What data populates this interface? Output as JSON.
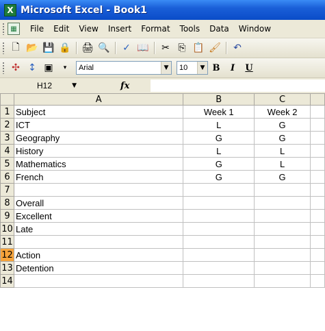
{
  "window": {
    "title": "Microsoft Excel - Book1",
    "app_icon_glyph": "X"
  },
  "menubar": {
    "items": [
      "File",
      "Edit",
      "View",
      "Insert",
      "Format",
      "Tools",
      "Data",
      "Window"
    ]
  },
  "formatting": {
    "font": "Arial",
    "size": "10",
    "bold": "B",
    "italic": "I",
    "underline": "U"
  },
  "formula_bar": {
    "name_box": "H12",
    "fx": "fx",
    "content": ""
  },
  "columns": [
    "A",
    "B",
    "C"
  ],
  "rows": [
    {
      "num": "1",
      "a": "Subject",
      "b": "Week 1",
      "c": "Week 2",
      "bold": true
    },
    {
      "num": "2",
      "a": "ICT",
      "b": "L",
      "c": "G"
    },
    {
      "num": "3",
      "a": "Geography",
      "b": "G",
      "c": "G"
    },
    {
      "num": "4",
      "a": "History",
      "b": "L",
      "c": "L"
    },
    {
      "num": "5",
      "a": "Mathematics",
      "b": "G",
      "c": "L"
    },
    {
      "num": "6",
      "a": "French",
      "b": "G",
      "c": "G"
    },
    {
      "num": "7",
      "a": "",
      "b": "",
      "c": ""
    },
    {
      "num": "8",
      "a": "Overall",
      "b": "",
      "c": "",
      "bold": true
    },
    {
      "num": "9",
      "a": "Excellent",
      "b": "",
      "c": ""
    },
    {
      "num": "10",
      "a": "Late",
      "b": "",
      "c": ""
    },
    {
      "num": "11",
      "a": "",
      "b": "",
      "c": ""
    },
    {
      "num": "12",
      "a": "Action",
      "b": "",
      "c": "",
      "bold": true,
      "selected": true
    },
    {
      "num": "13",
      "a": "Detention",
      "b": "",
      "c": ""
    },
    {
      "num": "14",
      "a": "",
      "b": "",
      "c": ""
    }
  ],
  "colors": {
    "title_bar": "#1a5fd8",
    "selected_row_header": "#f7a43b",
    "chrome": "#ece9d8"
  }
}
